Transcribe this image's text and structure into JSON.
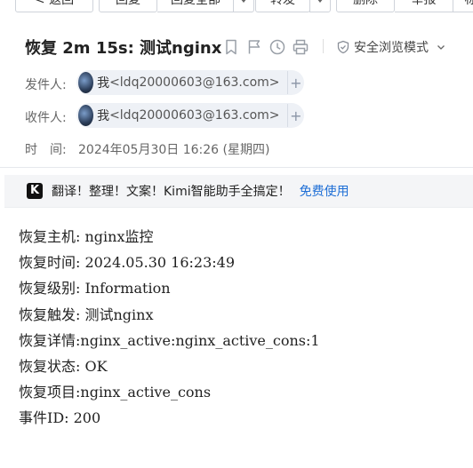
{
  "toolbar": {
    "back_label": "< 返回",
    "reply_label": "回复",
    "reply_all_label": "回复全部",
    "forward_label": "转发",
    "delete_label": "删除",
    "report_label": "举报",
    "more_label": "标"
  },
  "mail": {
    "subject": "恢复 2m 15s: 测试nginx",
    "safe_mode_label": "安全浏览模式",
    "from_label": "发件人:",
    "to_label": "收件人:",
    "date_label": "时　间:",
    "sender": {
      "name": "我",
      "email": "<ldq20000603@163.com>"
    },
    "recipient": {
      "name": "我",
      "email": "<ldq20000603@163.com>"
    },
    "date": "2024年05月30日 16:26 (星期四)"
  },
  "banner": {
    "icon_letter": "K",
    "text": "翻译！整理！文案！Kimi智能助手全搞定！",
    "link": "免费使用"
  },
  "body": {
    "lines": [
      "恢复主机: nginx监控",
      "恢复时间: 2024.05.30 16:23:49",
      "恢复级别: Information",
      "恢复触发: 测试nginx",
      "恢复详情:nginx_active:nginx_active_cons:1",
      "恢复状态: OK",
      "恢复项目:nginx_active_cons",
      "事件ID: 200"
    ]
  },
  "icons": {
    "bookmark": "bookmark-icon",
    "flag": "flag-icon",
    "clock": "clock-icon",
    "print": "print-icon",
    "shield": "shield-icon",
    "chevron": "chevron-down-icon",
    "plus": "plus-icon",
    "avatar": "avatar"
  },
  "colors": {
    "link": "#1f6fd6",
    "chip_bg": "#eef1f6"
  }
}
